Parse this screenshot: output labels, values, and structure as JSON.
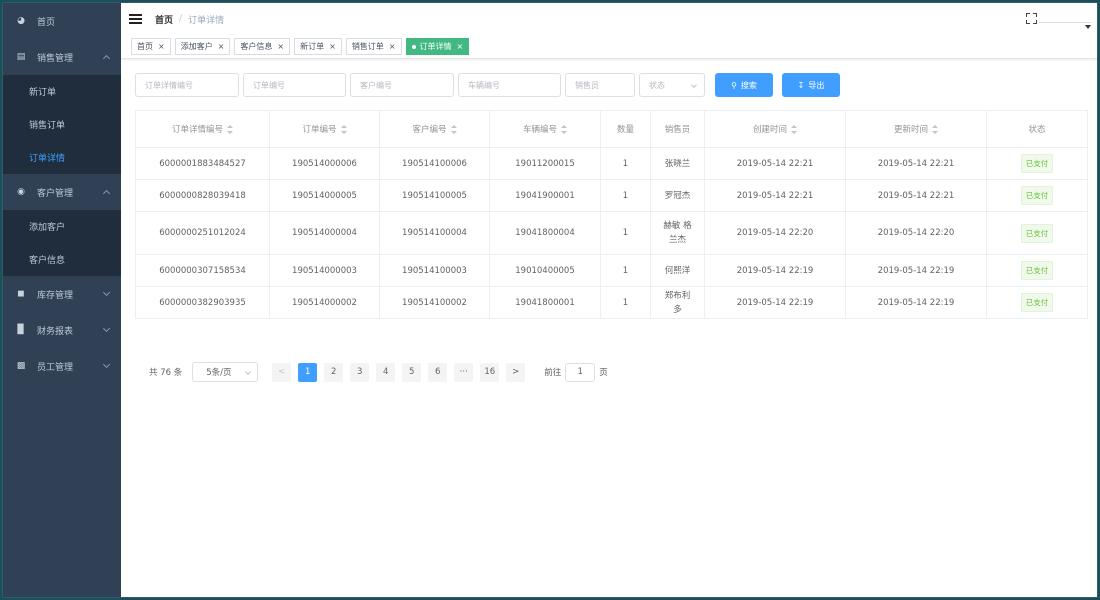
{
  "sidebar": {
    "home": {
      "label": "首页",
      "icon": "dashboard-icon"
    },
    "groups": [
      {
        "label": "销售管理",
        "icon": "document-icon",
        "expanded": true,
        "items": [
          {
            "label": "新订单",
            "active": false
          },
          {
            "label": "销售订单",
            "active": false
          },
          {
            "label": "订单详情",
            "active": true
          }
        ]
      },
      {
        "label": "客户管理",
        "icon": "eye-icon",
        "expanded": true,
        "items": [
          {
            "label": "添加客户",
            "active": false
          },
          {
            "label": "客户信息",
            "active": false
          }
        ]
      },
      {
        "label": "库存管理",
        "icon": "car-icon",
        "expanded": false,
        "items": []
      },
      {
        "label": "财务报表",
        "icon": "bar-chart-icon",
        "expanded": false,
        "items": []
      },
      {
        "label": "员工管理",
        "icon": "badge-icon",
        "expanded": false,
        "items": []
      }
    ]
  },
  "header": {
    "breadcrumb_home": "首页",
    "breadcrumb_sep": "/",
    "breadcrumb_current": "订单详情"
  },
  "tags": [
    {
      "label": "首页",
      "active": false
    },
    {
      "label": "添加客户",
      "active": false
    },
    {
      "label": "客户信息",
      "active": false
    },
    {
      "label": "新订单",
      "active": false
    },
    {
      "label": "销售订单",
      "active": false
    },
    {
      "label": "订单详情",
      "active": true
    }
  ],
  "tag_close": "×",
  "filters": {
    "detail_no": "订单详情编号",
    "order_no": "订单编号",
    "customer_no": "客户编号",
    "vehicle_no": "车辆编号",
    "salesperson": "销售员",
    "status": "状态",
    "search_label": "搜索",
    "export_label": "导出"
  },
  "table": {
    "columns": [
      "订单详情编号",
      "订单编号",
      "客户编号",
      "车辆编号",
      "数量",
      "销售员",
      "创建时间",
      "更新时间",
      "状态"
    ],
    "rows": [
      {
        "detail_no": "6000001883484527",
        "order_no": "190514000006",
        "customer_no": "190514100006",
        "vehicle_no": "19011200015",
        "qty": "1",
        "sales": "张晓兰",
        "created": "2019-05-14 22:21",
        "updated": "2019-05-14 22:21",
        "status": "已支付"
      },
      {
        "detail_no": "6000000828039418",
        "order_no": "190514000005",
        "customer_no": "190514100005",
        "vehicle_no": "19041900001",
        "qty": "1",
        "sales": "罗冠杰",
        "created": "2019-05-14 22:21",
        "updated": "2019-05-14 22:21",
        "status": "已支付"
      },
      {
        "detail_no": "6000000251012024",
        "order_no": "190514000004",
        "customer_no": "190514100004",
        "vehicle_no": "19041800004",
        "qty": "1",
        "sales": "赫敏 格兰杰",
        "created": "2019-05-14 22:20",
        "updated": "2019-05-14 22:20",
        "status": "已支付"
      },
      {
        "detail_no": "6000000307158534",
        "order_no": "190514000003",
        "customer_no": "190514100003",
        "vehicle_no": "19010400005",
        "qty": "1",
        "sales": "何熙洋",
        "created": "2019-05-14 22:19",
        "updated": "2019-05-14 22:19",
        "status": "已支付"
      },
      {
        "detail_no": "6000000382903935",
        "order_no": "190514000002",
        "customer_no": "190514100002",
        "vehicle_no": "19041800001",
        "qty": "1",
        "sales": "郑布利多",
        "created": "2019-05-14 22:19",
        "updated": "2019-05-14 22:19",
        "status": "已支付"
      }
    ]
  },
  "pagination": {
    "total": "共 76 条",
    "page_size": "5条/页",
    "prev": "<",
    "next": ">",
    "pages": [
      "1",
      "2",
      "3",
      "4",
      "5",
      "6",
      "···",
      "16"
    ],
    "current": "1",
    "jump_label": "前往",
    "jump_value": "1",
    "jump_suffix": "页"
  },
  "colors": {
    "sidebar_bg": "#304156",
    "sidebar_active_text": "#409eff",
    "tag_active": "#42b983",
    "primary": "#409eff",
    "status_green": "#67c23a"
  }
}
